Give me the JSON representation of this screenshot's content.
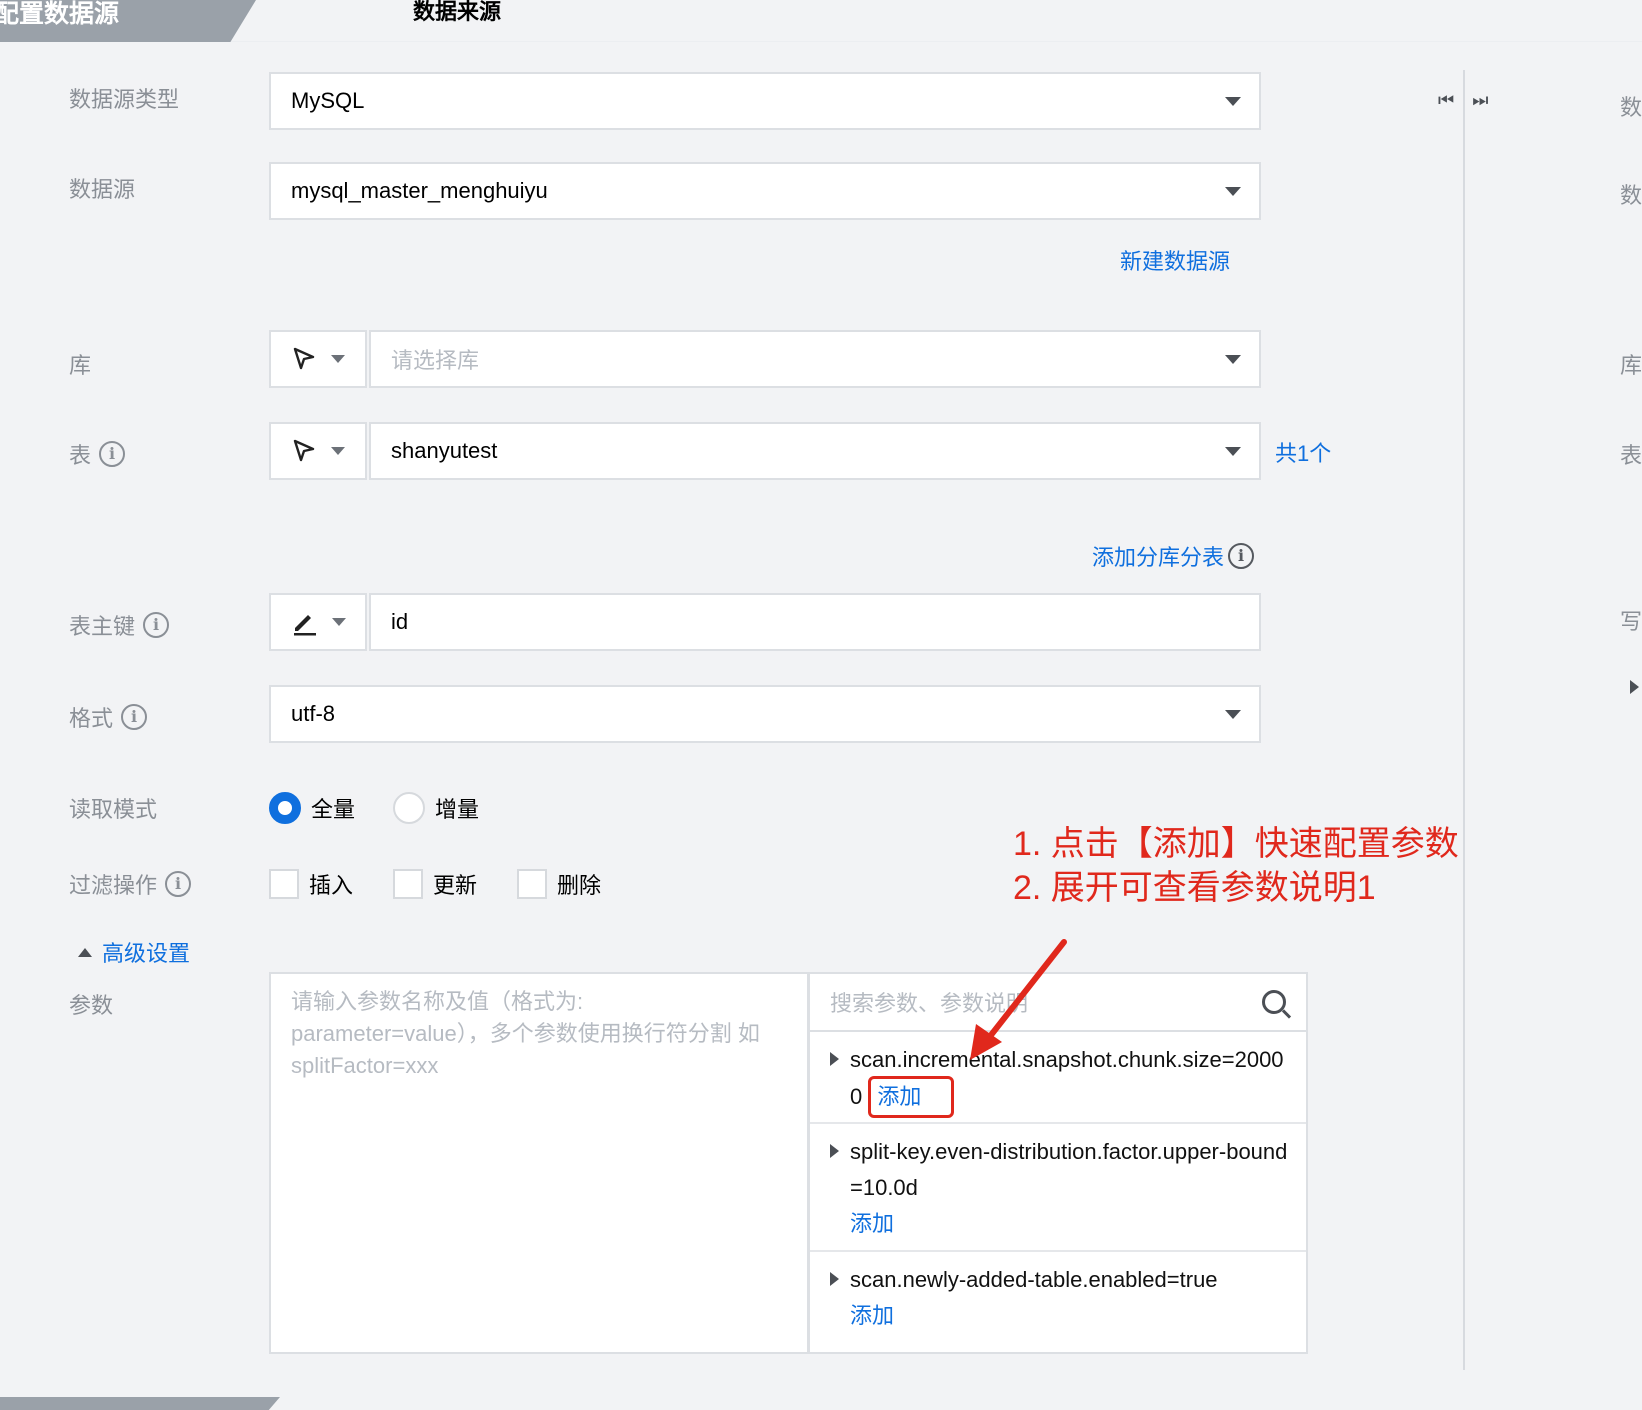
{
  "header": {
    "step_title": "配置数据源",
    "source_title": "数据来源"
  },
  "form": {
    "source_type": {
      "label": "数据源类型",
      "value": "MySQL"
    },
    "source": {
      "label": "数据源",
      "value": "mysql_master_menghuiyu",
      "new_link": "新建数据源"
    },
    "database": {
      "label": "库",
      "placeholder": "请选择库",
      "mode_icon": "cursor-arrow-icon"
    },
    "table": {
      "label": "表",
      "value": "shanyutest",
      "count": "共1个",
      "mode_icon": "cursor-arrow-icon",
      "shard_link": "添加分库分表"
    },
    "primary_key": {
      "label": "表主键",
      "value": "id",
      "mode_icon": "pen-icon"
    },
    "format": {
      "label": "格式",
      "value": "utf-8"
    },
    "read_mode": {
      "label": "读取模式",
      "options": [
        "全量",
        "增量"
      ],
      "selected": "全量"
    },
    "filter_ops": {
      "label": "过滤操作",
      "options": [
        "插入",
        "更新",
        "删除"
      ]
    },
    "advanced": {
      "toggle_label": "高级设置"
    },
    "params": {
      "label": "参数",
      "placeholder": "请输入参数名称及值（格式为: parameter=value），多个参数使用换行符分割 如splitFactor=xxx",
      "search_placeholder": "搜索参数、参数说明",
      "add_label": "添加",
      "items": [
        {
          "name": "scan.incremental.snapshot.chunk.size=20000"
        },
        {
          "name": "split-key.even-distribution.factor.upper-bound=10.0d"
        },
        {
          "name": "scan.newly-added-table.enabled=true"
        }
      ]
    }
  },
  "annotation": {
    "line1": "1. 点击【添加】快速配置参数",
    "line2": "2. 展开可查看参数说明1",
    "color": "#e0281c"
  },
  "right_panel": {
    "labels": [
      "数",
      "数",
      "库",
      "表",
      "写"
    ]
  },
  "colors": {
    "accent": "#0f6fde",
    "border": "#dcdfe3",
    "label": "#8a8f96"
  }
}
